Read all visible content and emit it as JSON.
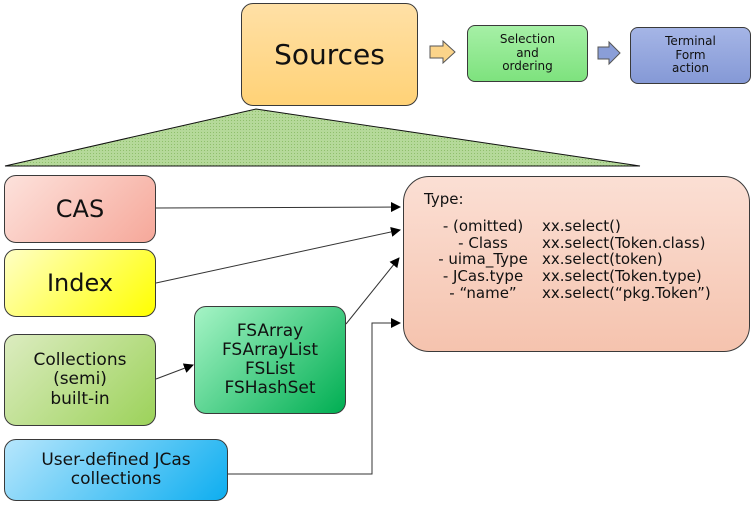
{
  "top_flow": {
    "sources": "Sources",
    "selection": [
      "Selection",
      "and",
      "ordering"
    ],
    "terminal": [
      "Terminal",
      "Form",
      "action"
    ]
  },
  "sources_list": {
    "cas": "CAS",
    "index": "Index",
    "collections": [
      "Collections",
      "(semi)",
      "built-in"
    ],
    "fs_collections": [
      "FSArray",
      "FSArrayList",
      "FSList",
      "FSHashSet"
    ],
    "user_defined": [
      "User-defined JCas",
      "collections"
    ]
  },
  "type_box": {
    "title": "Type:",
    "rows": [
      {
        "kind": "- (omitted)",
        "example": "xx.select()"
      },
      {
        "kind": "- Class",
        "example": "xx.select(Token.class)"
      },
      {
        "kind": "- uima_Type",
        "example": "xx.select(token)"
      },
      {
        "kind": "- JCas.type",
        "example": "xx.select(Token.type)"
      },
      {
        "kind": "- “name”",
        "example": "xx.select(“pkg.Token”)"
      }
    ]
  },
  "colors": {
    "sources": "#ffd277",
    "selection": "#7ee27e",
    "terminal": "#8599d6",
    "cas": "#f6a89a",
    "index": "#ffff00",
    "collections": "#9cd25a",
    "fs_collections": "#00ae52",
    "user_defined": "#0eaef0",
    "type_box": "#f5c3ae",
    "fan_triangle": "#a8d08d"
  }
}
